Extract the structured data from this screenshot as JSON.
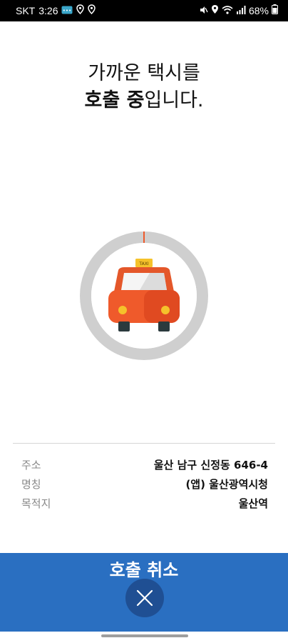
{
  "status_bar": {
    "carrier": "SKT",
    "time": "3:26",
    "battery": "68%"
  },
  "title": {
    "line1": "가까운 택시를",
    "line2_bold": "호출 중",
    "line2_rest": "입니다."
  },
  "taxi_sign": "TAXI",
  "info": [
    {
      "label": "주소",
      "value": "울산 남구 신정동 646-4"
    },
    {
      "label": "명칭",
      "value": "(앱) 울산광역시청"
    },
    {
      "label": "목적지",
      "value": "울산역"
    }
  ],
  "cancel": {
    "label": "호출 취소"
  },
  "colors": {
    "accent": "#2a6fc1",
    "cancel_button": "#1f4f93",
    "taxi_body": "#ef5a2b",
    "ring": "#cfcfcf"
  }
}
